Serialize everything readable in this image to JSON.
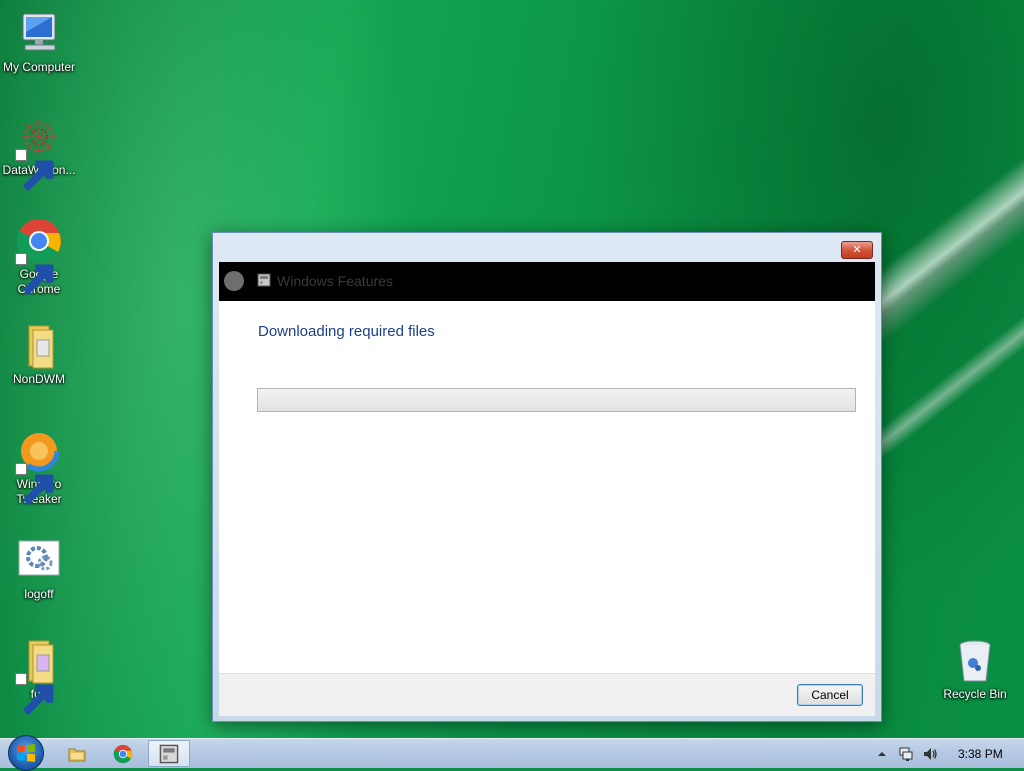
{
  "desktop": {
    "icons": [
      {
        "label": "My Computer",
        "icon": "computer-icon"
      },
      {
        "label": "DataWagon...",
        "icon": "datawagon-icon"
      },
      {
        "label": "Google Chrome",
        "icon": "chrome-icon"
      },
      {
        "label": "NonDWM",
        "icon": "folder-icon"
      },
      {
        "label": "Winaero Tweaker",
        "icon": "winaero-tweaker-icon"
      },
      {
        "label": "logoff",
        "icon": "logoff-icon"
      },
      {
        "label": "fun",
        "icon": "folder-icon"
      },
      {
        "label": "Recycle Bin",
        "icon": "recycle-bin-icon"
      }
    ]
  },
  "dialog": {
    "title": "Windows Features",
    "close_label": "✕",
    "heading": "Downloading required files",
    "progress_value": 0,
    "cancel_label": "Cancel"
  },
  "taskbar": {
    "items": [
      "start-button",
      "explorer-icon",
      "chrome-icon",
      "windows-features-icon"
    ],
    "tray": [
      "show-hidden-icons-icon",
      "network-icon",
      "volume-icon"
    ],
    "clock": "3:38 PM"
  },
  "colors": {
    "desktop_green": "#0d9146",
    "heading_blue": "#1e3f87",
    "close_red": "#c13b22",
    "header_band": "#000000"
  }
}
